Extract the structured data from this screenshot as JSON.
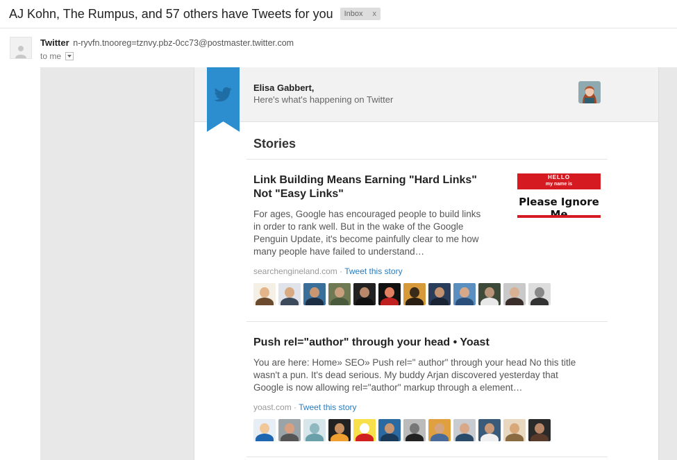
{
  "subject": {
    "text": "AJ Kohn, The Rumpus, and 57 others have Tweets for you",
    "label": "Inbox",
    "label_close": "x"
  },
  "message": {
    "sender_name": "Twitter",
    "sender_address": "n-ryvfn.tnooreg=tznvy.pbz-0cc73@postmaster.twitter.com",
    "recipient": "to me"
  },
  "email": {
    "greeting_name": "Elisa Gabbert,",
    "greeting_sub": "Here's what's happening on Twitter",
    "section_title": "Stories",
    "stories": [
      {
        "title_line1": "Link Building Means Earning \"Hard Links\"",
        "title_line2": "Not \"Easy Links\"",
        "body": [
          "For ages, Google has encouraged people to build links",
          "in order to rank well. But in the wake of the Google",
          "Penguin Update, it's become painfully clear to me how",
          "many people have failed to understand…"
        ],
        "source": "searchengineland.com",
        "separator": " · ",
        "tweet_link": "Tweet this story",
        "image": {
          "hello": "HELLO",
          "my_name_is": "my name is",
          "name_text": "Please Ignore Me"
        }
      },
      {
        "title_line1": "Push rel=\"author\" through your head • Yoast",
        "body": [
          "You are here: Home» SEO» Push rel=\" author\" through your head No this title",
          "wasn't a pun. It's dead serious. My buddy Arjan discovered yesterday that",
          "Google is now allowing rel=\"author\" markup through a element…"
        ],
        "source": "yoast.com",
        "separator": " · ",
        "tweet_link": "Tweet this story"
      }
    ]
  },
  "colors": {
    "twitter_blue": "#2b7bb9",
    "ribbon_blue": "#2c8ecf",
    "badge_red": "#d61a21"
  },
  "icons": [
    "person-icon",
    "twitter-bird-icon",
    "chevron-down-icon"
  ]
}
